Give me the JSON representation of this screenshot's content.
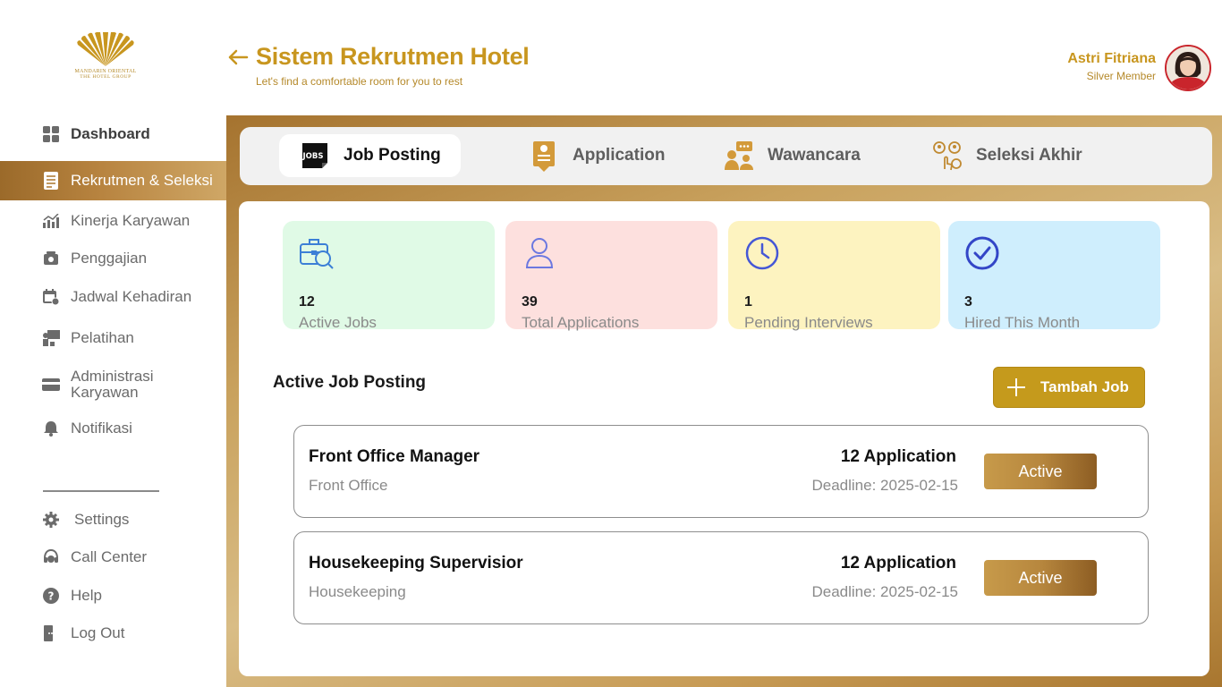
{
  "brand": {
    "line1": "MANDARIN ORIENTAL",
    "line2": "THE HOTEL GROUP",
    "color": "#c8961f"
  },
  "header": {
    "title": "Sistem Rekrutmen Hotel",
    "subtitle": "Let's find a comfortable room for you to rest"
  },
  "user": {
    "name": "Astri Fitriana",
    "level": "Silver Member"
  },
  "sidebar": {
    "items": [
      {
        "label": "Dashboard",
        "icon": "grid-icon"
      },
      {
        "label": "Rekrutmen & Seleksi",
        "icon": "document-icon",
        "active": true
      },
      {
        "label": "Kinerja Karyawan",
        "icon": "chart-icon"
      },
      {
        "label": "Penggajian",
        "icon": "money-icon"
      },
      {
        "label": "Jadwal Kehadiran",
        "icon": "calendar-icon"
      },
      {
        "label": "Pelatihan",
        "icon": "training-icon"
      },
      {
        "label": "Administrasi Karyawan",
        "icon": "card-icon"
      },
      {
        "label": "Notifikasi",
        "icon": "bell-icon"
      }
    ],
    "bottom": [
      {
        "label": "Settings",
        "icon": "gear-icon"
      },
      {
        "label": "Call Center",
        "icon": "headset-icon"
      },
      {
        "label": "Help",
        "icon": "help-icon"
      },
      {
        "label": "Log Out",
        "icon": "logout-icon"
      }
    ]
  },
  "tabs": [
    {
      "label": "Job Posting",
      "icon": "jobs-icon",
      "selected": true
    },
    {
      "label": "Application",
      "icon": "application-icon"
    },
    {
      "label": "Wawancara",
      "icon": "interview-icon"
    },
    {
      "label": "Seleksi Akhir",
      "icon": "selection-icon"
    }
  ],
  "stats": [
    {
      "value": "12",
      "label": "Active Jobs",
      "bg": "#e0fae6",
      "icon": "briefcase-search-icon"
    },
    {
      "value": "39",
      "label": "Total Applications",
      "bg": "#fde0de",
      "icon": "person-icon"
    },
    {
      "value": "1",
      "label": "Pending Interviews",
      "bg": "#fdf3c0",
      "icon": "clock-icon"
    },
    {
      "value": "3",
      "label": "Hired This Month",
      "bg": "#cfeefd",
      "icon": "check-circle-icon"
    }
  ],
  "section": {
    "title": "Active Job Posting",
    "add_label": "Tambah Job"
  },
  "jobs": [
    {
      "title": "Front Office Manager",
      "department": "Front Office",
      "applications": "12 Application",
      "deadline": "Deadline: 2025-02-15",
      "status": "Active"
    },
    {
      "title": "Housekeeping Supervisior",
      "department": "Housekeeping",
      "applications": "12 Application",
      "deadline": "Deadline: 2025-02-15",
      "status": "Active"
    }
  ]
}
